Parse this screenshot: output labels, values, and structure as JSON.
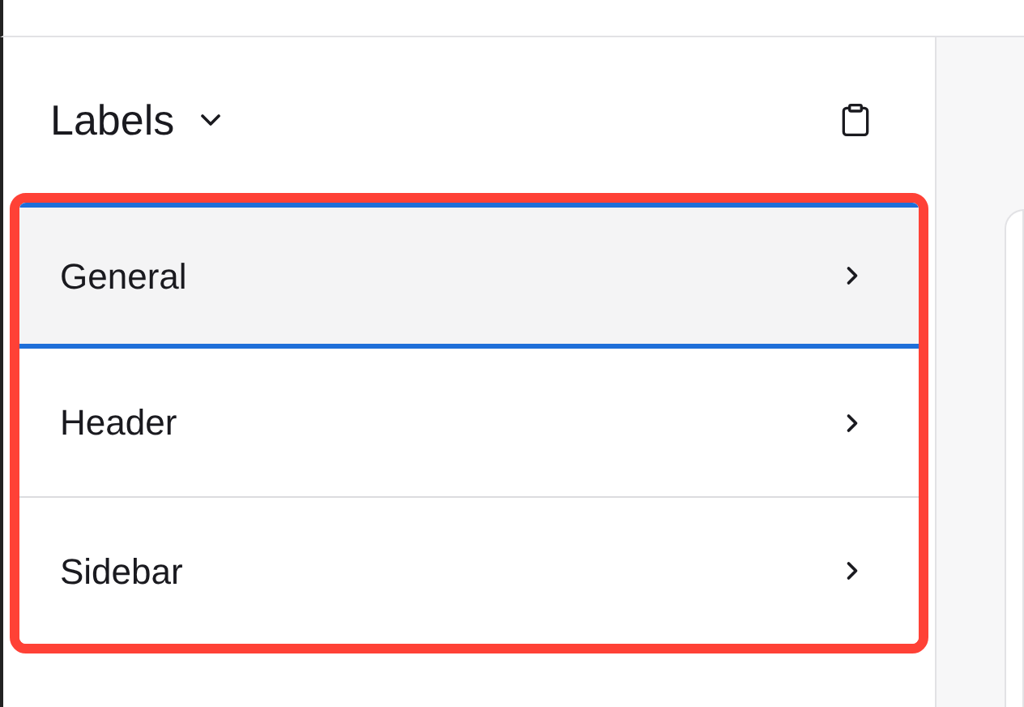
{
  "panel": {
    "title": "Labels"
  },
  "items": [
    {
      "label": "General",
      "selected": true
    },
    {
      "label": "Header",
      "selected": false
    },
    {
      "label": "Sidebar",
      "selected": false
    }
  ]
}
